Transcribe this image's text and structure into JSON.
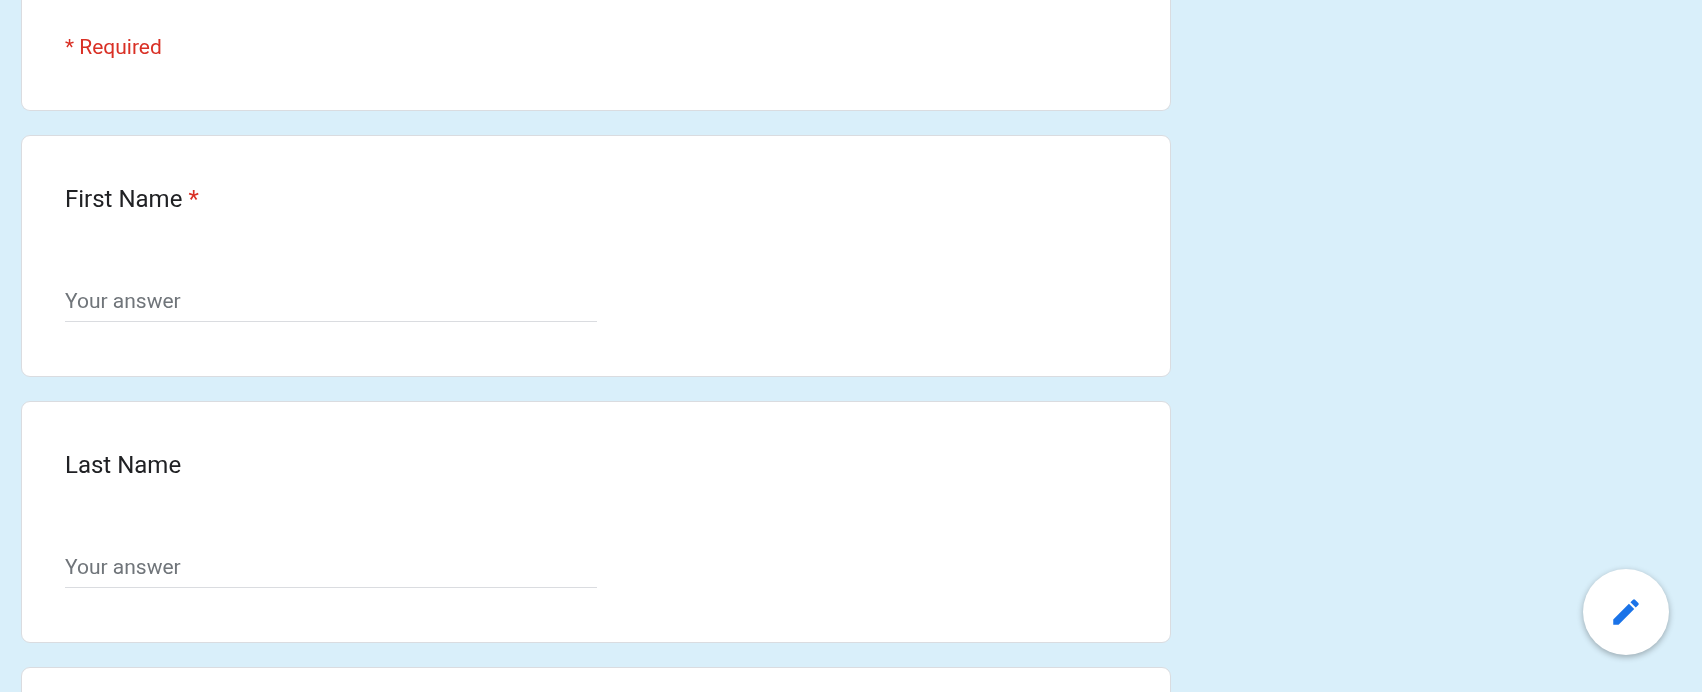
{
  "header_card": {
    "required_note": "* Required"
  },
  "questions": [
    {
      "title": "First Name",
      "required_mark": "*",
      "placeholder": "Your answer"
    },
    {
      "title": "Last Name",
      "placeholder": "Your answer"
    }
  ]
}
